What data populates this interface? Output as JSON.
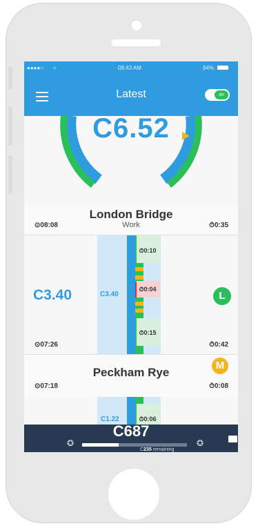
{
  "status_bar": {
    "signal": "●●●●○",
    "time": "08:43 AM",
    "battery": "94%"
  },
  "header": {
    "title": "Latest",
    "toggle_label": "on"
  },
  "gauge": {
    "currency_symbol": "C",
    "value": "6.52"
  },
  "trip": {
    "station": "London Bridge",
    "label": "Work",
    "depart_time": "08:08",
    "duration": "0:35"
  },
  "detail": {
    "fare": "3.40",
    "lane_fare": "3.40",
    "segments": [
      {
        "duration": "0:10",
        "color": "#d9f0dc"
      },
      {
        "duration": "0:04",
        "color": "#f7d2d2"
      },
      {
        "duration": "0:15",
        "color": "#d9f0dc"
      }
    ],
    "time_start": "07:26",
    "total_duration": "0:42",
    "line_badge": "L",
    "line_badge_color": "#2bbf5b"
  },
  "station2": {
    "name": "Peckham Rye",
    "time": "07:18",
    "duration": "0:08",
    "badge": "M",
    "badge_color": "#f2b51f"
  },
  "detail2": {
    "lane_fare": "1.22",
    "segment_duration": "0:06"
  },
  "bottom": {
    "total": "687",
    "remaining_amount": "235",
    "remaining_text": "remaining",
    "progress_fraction": 0.35
  },
  "colors": {
    "blue": "#2f9ce0",
    "green": "#2bbf5b",
    "dark": "#273a52"
  }
}
